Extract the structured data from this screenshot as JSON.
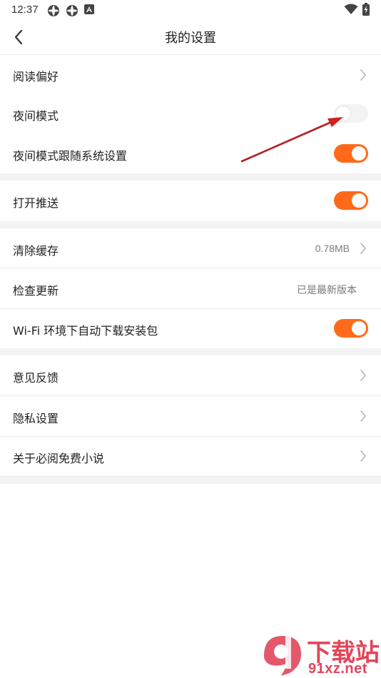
{
  "status_bar": {
    "time": "12:37",
    "icons": [
      "app-notification-icon",
      "app-notification-icon",
      "accessibility-icon",
      "wifi-icon",
      "battery-charging-icon"
    ]
  },
  "header": {
    "title": "我的设置",
    "back_icon": "chevron-left-icon"
  },
  "settings": {
    "reading_pref": {
      "label": "阅读偏好"
    },
    "night_mode": {
      "label": "夜间模式",
      "enabled": false
    },
    "night_follow": {
      "label": "夜间模式跟随系统设置",
      "enabled": true
    },
    "push": {
      "label": "打开推送",
      "enabled": true
    },
    "clear_cache": {
      "label": "清除缓存",
      "value": "0.78MB"
    },
    "check_update": {
      "label": "检查更新",
      "value": "已是最新版本"
    },
    "wifi_download": {
      "label": "Wi-Fi 环境下自动下载安装包",
      "enabled": true
    },
    "feedback": {
      "label": "意见反馈"
    },
    "privacy": {
      "label": "隐私设置"
    },
    "about": {
      "label": "关于必阅免费小说"
    }
  },
  "colors": {
    "accent": "#ff6a1a",
    "arrow": "#d0201f",
    "section_gap": "#f3f3f3",
    "watermark": "#e2455a"
  },
  "watermark": {
    "main": "下载站",
    "url": "91xz.net"
  }
}
